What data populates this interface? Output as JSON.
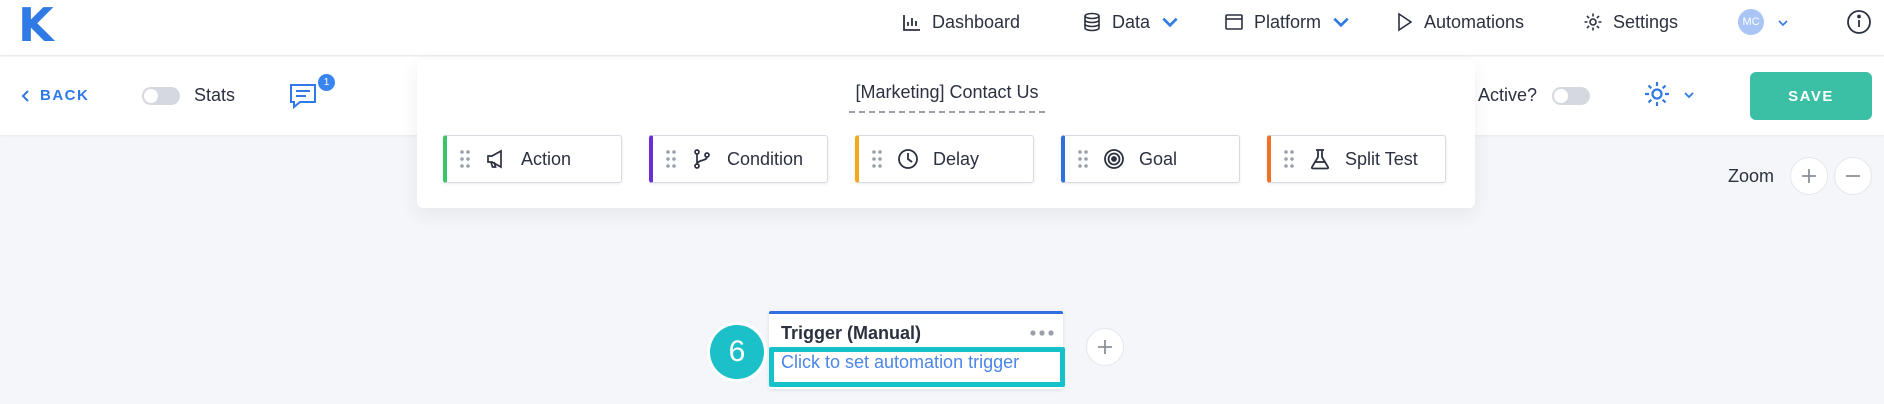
{
  "app": {
    "logo": "K"
  },
  "nav": {
    "dashboard": "Dashboard",
    "data": "Data",
    "platform": "Platform",
    "automations": "Automations",
    "settings": "Settings",
    "avatar_initials": "MC"
  },
  "toolbar": {
    "back": "BACK",
    "stats": "Stats",
    "comment_count": "1",
    "automation_title": "[Marketing] Contact Us",
    "active_label": "Active?",
    "save": "SAVE"
  },
  "palette": {
    "blocks": [
      {
        "label": "Action",
        "color": "#3cc46a",
        "icon": "megaphone-icon"
      },
      {
        "label": "Condition",
        "color": "#6b2fd6",
        "icon": "branch-icon"
      },
      {
        "label": "Delay",
        "color": "#f3a81c",
        "icon": "clock-icon"
      },
      {
        "label": "Goal",
        "color": "#2f6fe0",
        "icon": "target-icon"
      },
      {
        "label": "Split Test",
        "color": "#f07026",
        "icon": "flask-icon"
      }
    ]
  },
  "zoom": {
    "label": "Zoom"
  },
  "trigger_node": {
    "title": "Trigger (Manual)",
    "link": "Click to set automation trigger",
    "step_number": "6"
  },
  "colors": {
    "brand": "#2f7ae5",
    "save": "#3bbfa5",
    "highlight": "#16c2c9"
  }
}
